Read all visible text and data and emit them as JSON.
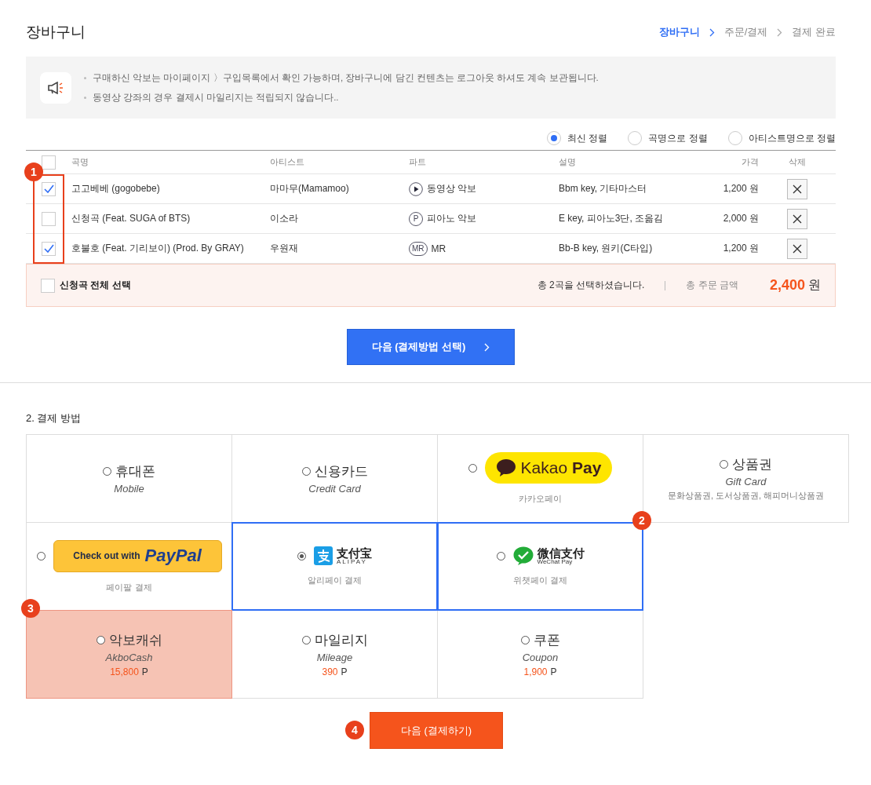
{
  "title": "장바구니",
  "steps": [
    {
      "label": "장바구니",
      "selected": true
    },
    {
      "label": "주문/결제",
      "selected": false
    },
    {
      "label": "결제 완료",
      "selected": false
    }
  ],
  "notices": [
    "구매하신 악보는 마이페이지 〉구입목록에서 확인 가능하며, 장바구니에 담긴 컨텐츠는 로그아웃 하셔도 계속 보관됩니다.",
    "동영상 강좌의 경우 결제시 마일리지는 적립되지 않습니다.."
  ],
  "sort_options": [
    {
      "label": "최신 정렬",
      "selected": true
    },
    {
      "label": "곡명으로 정렬",
      "selected": false
    },
    {
      "label": "아티스트명으로 정렬",
      "selected": false
    }
  ],
  "table": {
    "select_all_checked": false,
    "checkbox_callout": "1",
    "columns": [
      "곡명",
      "아티스트",
      "파트",
      "설명",
      "가격",
      "삭제"
    ],
    "rows": [
      {
        "checked": true,
        "title": "고고베베 (gogobebe)",
        "artist": "마마무(Mamamoo)",
        "part": {
          "kind": "video",
          "label": "동영상 악보"
        },
        "description": "Bbm key, 기타마스터",
        "price": "1,200 원"
      },
      {
        "checked": false,
        "title": "신청곡 (Feat. SUGA of BTS)",
        "artist": "이소라",
        "part": {
          "kind": "piano",
          "badge": "P",
          "label": "피아노 악보"
        },
        "description": "E key, 피아노3단, 조옮김",
        "price": "2,000 원"
      },
      {
        "checked": true,
        "title": "호불호 (Feat. 기리보이) (Prod. By GRAY)",
        "artist": "우원재",
        "part": {
          "kind": "mr",
          "badge": "MR",
          "label": "MR"
        },
        "description": "Bb-B key, 원키(C타입)",
        "price": "1,200 원"
      }
    ]
  },
  "summary": {
    "checked": false,
    "label": "신청곡 전체 선택",
    "count_text": "총 2곡을 선택하셨습니다.",
    "total_label": "총 주문 금액",
    "total": "2,400",
    "unit": "원"
  },
  "next_button": "다음 (결제방법 선택)",
  "payment": {
    "title": "2. 결제 방법",
    "rows": [
      [
        {
          "kind": "text",
          "name": "휴대폰",
          "subtitle": "Mobile",
          "selected": false
        },
        {
          "kind": "text",
          "name": "신용카드",
          "subtitle": "Credit Card",
          "selected": false
        },
        {
          "kind": "kakaopay",
          "logo_text": "Kakao",
          "logo_strong": "Pay",
          "caption": "카카오페이",
          "selected": false
        },
        {
          "kind": "text",
          "name": "상품권",
          "subtitle": "Gift Card",
          "note": "문화상품권, 도서상품권, 해피머니상품권",
          "selected": false
        }
      ],
      [
        {
          "kind": "paypal",
          "logo_text": "Check out with",
          "logo_strong": "PayPal",
          "caption": "페이팔 결제",
          "selected": false
        },
        {
          "kind": "alipay",
          "logo_text": "支付宝",
          "logo_strong": "ALIPAY",
          "caption": "알리페이 결제",
          "selected": true,
          "outlined": true
        },
        {
          "kind": "wechat",
          "logo_text": "微信支付",
          "logo_strong": "WeChat Pay",
          "caption": "위챗페이 결제",
          "selected": false,
          "outlined": true,
          "callout": "2"
        }
      ],
      [
        {
          "kind": "points",
          "name": "악보캐쉬",
          "subtitle": "AkboCash",
          "amount": "15,800",
          "unit": "P",
          "selected": false,
          "shaded": true,
          "callout": "3"
        },
        {
          "kind": "points",
          "name": "마일리지",
          "subtitle": "Mileage",
          "amount": "390",
          "unit": "P",
          "selected": false
        },
        {
          "kind": "points",
          "name": "쿠폰",
          "subtitle": "Coupon",
          "amount": "1,900",
          "unit": "P",
          "selected": false
        }
      ]
    ],
    "pay_button": "다음 (결제하기)",
    "pay_callout": "4"
  }
}
